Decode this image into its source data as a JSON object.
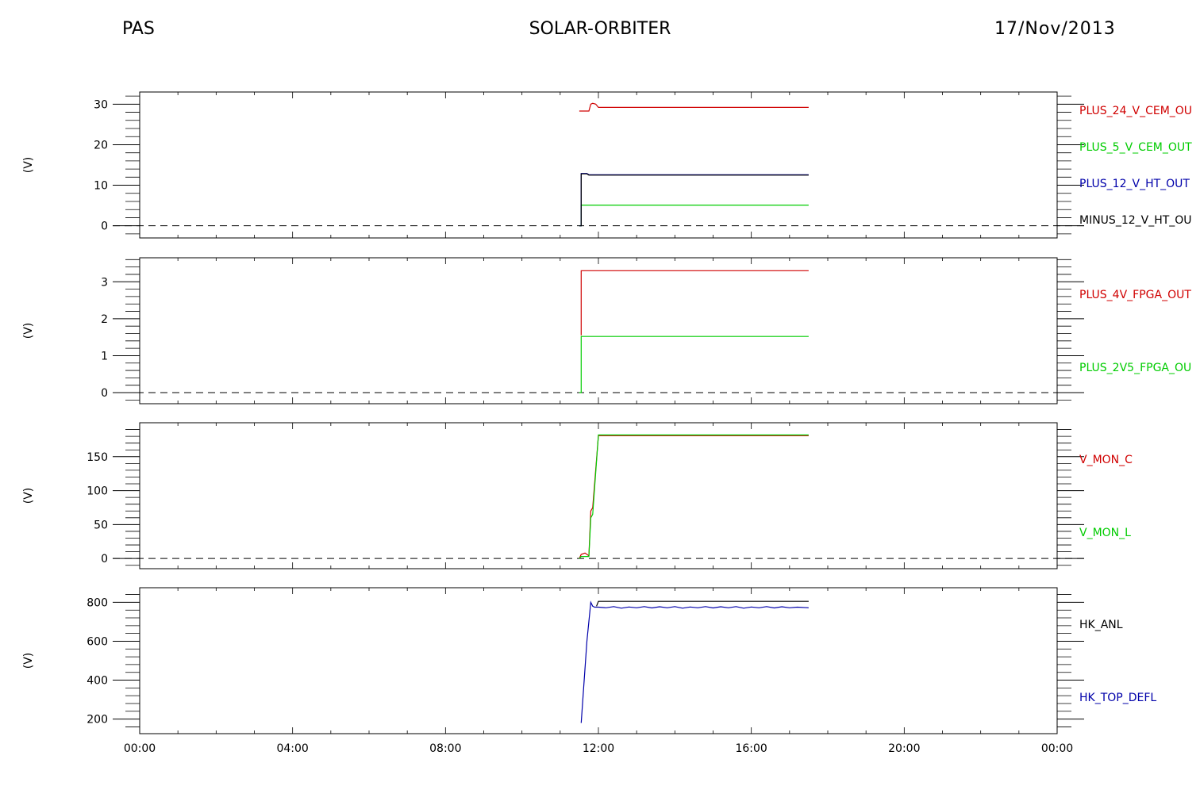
{
  "header": {
    "left": "PAS",
    "center": "SOLAR-ORBITER",
    "right": "17/Nov/2013"
  },
  "chart_data": [
    {
      "type": "line",
      "ylabel": "(V)",
      "ylim": [
        -3,
        33
      ],
      "yticks": [
        0,
        10,
        20,
        30
      ],
      "xlim": [
        0,
        24
      ],
      "xticks": [
        "00:00",
        "04:00",
        "08:00",
        "12:00",
        "16:00",
        "20:00",
        "00:00"
      ],
      "zero_line": true,
      "series": [
        {
          "name": "PLUS_24_V_CEM_OUT",
          "label": "PLUS_24_V_CEM_OU",
          "color": "#d00000",
          "x": [
            11.5,
            11.75,
            11.8,
            11.85,
            11.93,
            12.0,
            17.5
          ],
          "y": [
            28.3,
            28.3,
            30.0,
            30.2,
            30.0,
            29.2,
            29.2
          ]
        },
        {
          "name": "PLUS_5_V_CEM_OUT",
          "label": "PLUS_5_V_CEM_OUT",
          "color": "#00cc00",
          "x": [
            11.5,
            11.55,
            11.55,
            17.5
          ],
          "y": [
            0,
            0,
            5.1,
            5.1
          ]
        },
        {
          "name": "PLUS_12_V_HT_OUT",
          "label": "PLUS_12_V_HT_OUT",
          "color": "#0000aa",
          "x": [
            11.5,
            11.55,
            11.55,
            11.7,
            11.75,
            17.5
          ],
          "y": [
            0,
            0,
            12.9,
            12.9,
            12.6,
            12.6
          ]
        },
        {
          "name": "MINUS_12_V_HT_OUT",
          "label": "MINUS_12_V_HT_OU",
          "color": "#000000",
          "x": [
            11.5,
            11.55,
            11.55,
            11.7,
            11.75,
            17.5
          ],
          "y": [
            0,
            0,
            12.8,
            12.8,
            12.5,
            12.5
          ]
        }
      ]
    },
    {
      "type": "line",
      "ylabel": "(V)",
      "ylim": [
        -0.3,
        3.65
      ],
      "yticks": [
        0,
        1,
        2,
        3
      ],
      "xlim": [
        0,
        24
      ],
      "zero_line": true,
      "series": [
        {
          "name": "PLUS_4V_FPGA_OUT",
          "label": "PLUS_4V_FPGA_OUT",
          "color": "#d00000",
          "x": [
            11.55,
            11.55,
            17.5
          ],
          "y": [
            1.55,
            3.3,
            3.3
          ]
        },
        {
          "name": "PLUS_2V5_FPGA_OUT",
          "label": "PLUS_2V5_FPGA_OU",
          "color": "#00cc00",
          "x": [
            11.5,
            11.55,
            11.55,
            17.5
          ],
          "y": [
            0,
            0,
            1.52,
            1.52
          ]
        }
      ]
    },
    {
      "type": "line",
      "ylabel": "(V)",
      "ylim": [
        -15,
        200
      ],
      "yticks": [
        0,
        50,
        100,
        150
      ],
      "xlim": [
        0,
        24
      ],
      "zero_line": true,
      "series": [
        {
          "name": "V_MON_C",
          "label": "V_MON_C",
          "color": "#d00000",
          "x": [
            11.5,
            11.55,
            11.65,
            11.75,
            11.8,
            11.85,
            12.0,
            17.5
          ],
          "y": [
            0,
            6,
            8,
            4,
            70,
            75,
            181,
            181
          ]
        },
        {
          "name": "V_MON_L",
          "label": "V_MON_L",
          "color": "#00cc00",
          "x": [
            11.5,
            11.55,
            11.75,
            11.8,
            11.85,
            12.0,
            17.5
          ],
          "y": [
            0,
            3,
            3,
            60,
            65,
            182,
            182
          ]
        }
      ]
    },
    {
      "type": "line",
      "ylabel": "(V)",
      "ylim": [
        125,
        875
      ],
      "yticks": [
        200,
        400,
        600,
        800
      ],
      "xlim": [
        0,
        24
      ],
      "zero_line": false,
      "series": [
        {
          "name": "HK_ANL",
          "label": "HK_ANL",
          "color": "#000000",
          "x": [
            11.95,
            12.0,
            12.3,
            12.7,
            13.1,
            13.5,
            13.9,
            14.3,
            14.7,
            15.1,
            15.5,
            15.9,
            16.3,
            16.7,
            17.1,
            17.5
          ],
          "y": [
            780,
            805,
            805,
            805,
            805,
            805,
            805,
            805,
            805,
            805,
            805,
            805,
            805,
            805,
            805,
            805
          ]
        },
        {
          "name": "HK_TOP_DEFL",
          "label": "HK_TOP_DEFL",
          "color": "#0000aa",
          "x": [
            11.55,
            11.7,
            11.8,
            11.85,
            11.9,
            12.0,
            12.2,
            12.4,
            12.6,
            12.8,
            13.0,
            13.2,
            13.4,
            13.6,
            13.8,
            14.0,
            14.2,
            14.4,
            14.6,
            14.8,
            15.0,
            15.2,
            15.4,
            15.6,
            15.8,
            16.0,
            16.2,
            16.4,
            16.6,
            16.8,
            17.0,
            17.2,
            17.5
          ],
          "y": [
            180,
            600,
            800,
            780,
            775,
            775,
            772,
            778,
            770,
            776,
            772,
            778,
            771,
            777,
            772,
            778,
            770,
            776,
            772,
            778,
            771,
            777,
            772,
            778,
            770,
            776,
            772,
            778,
            771,
            777,
            772,
            775,
            772
          ]
        }
      ]
    }
  ]
}
